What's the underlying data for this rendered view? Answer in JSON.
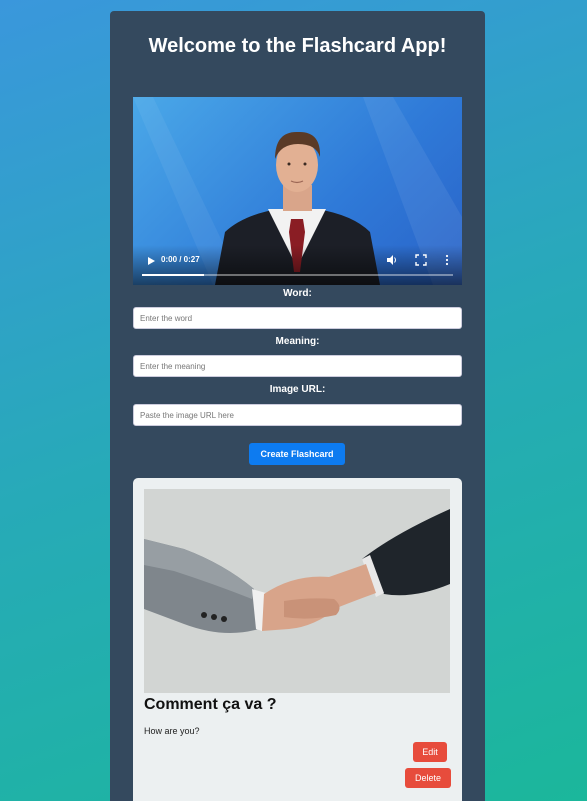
{
  "app": {
    "title": "Welcome to the Flashcard App!"
  },
  "video": {
    "time": "0:00 / 0:27",
    "progress": 0.2
  },
  "form": {
    "word_label": "Word:",
    "word_placeholder": "Enter the word",
    "meaning_label": "Meaning:",
    "meaning_placeholder": "Enter the meaning",
    "image_label": "Image URL:",
    "image_placeholder": "Paste the image URL here",
    "create_label": "Create Flashcard"
  },
  "card": {
    "word": "Comment ça va ?",
    "meaning": "How are you?",
    "edit_label": "Edit",
    "delete_label": "Delete"
  },
  "colors": {
    "panel": "#34495e",
    "primary": "#0d7bf0",
    "danger": "#e74c3c",
    "card_bg": "#ecf0f1"
  },
  "icons": [
    "play-icon",
    "volume-icon",
    "fullscreen-icon",
    "more-vert-icon"
  ]
}
